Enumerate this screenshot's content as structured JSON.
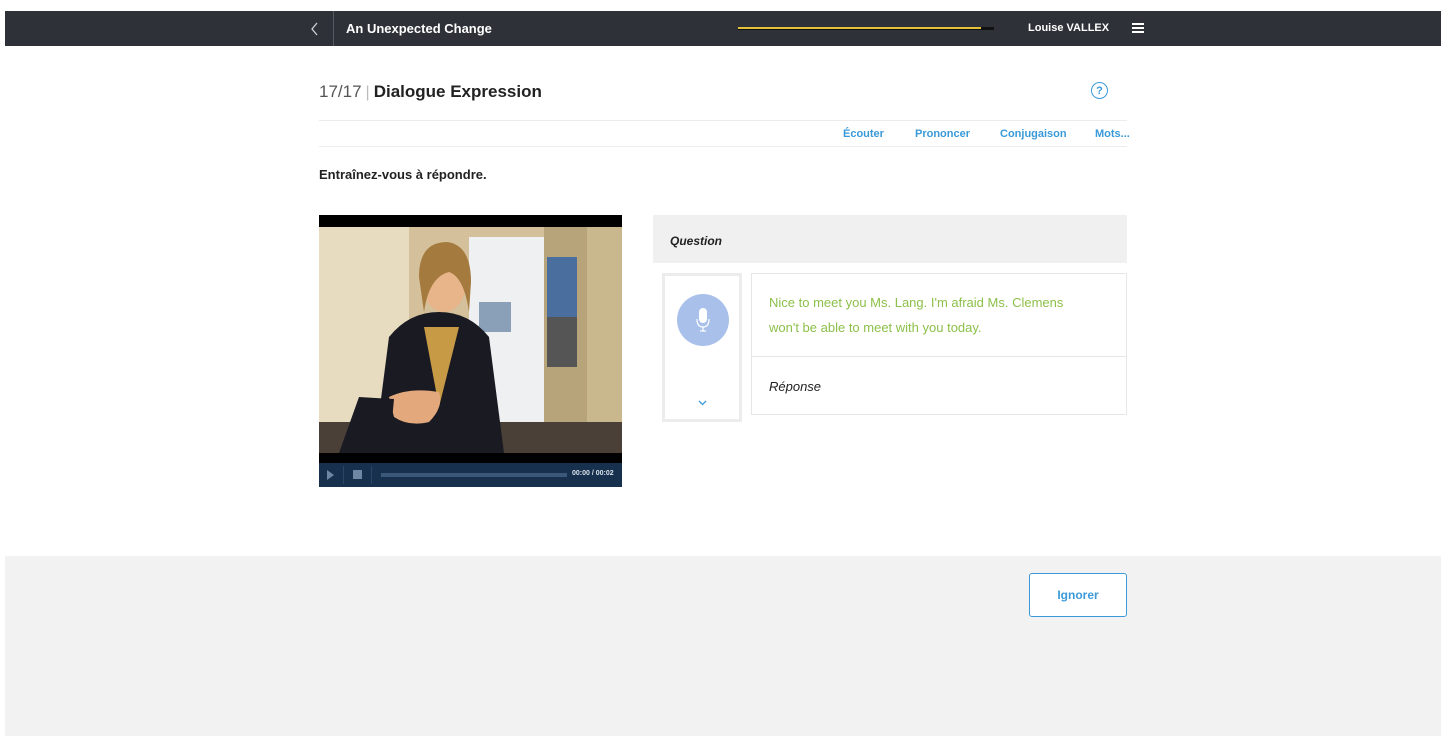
{
  "topbar": {
    "course_title": "An Unexpected Change",
    "user_name": "Louise VALLEX",
    "progress_fraction": 0.95,
    "progress_color": "#e3c23a"
  },
  "exercise": {
    "counter": "17/17",
    "title": "Dialogue Expression"
  },
  "tools": [
    "Écouter",
    "Prononcer",
    "Conjugaison",
    "Mots..."
  ],
  "instruction": "Entraînez-vous à répondre.",
  "video": {
    "time": "00:00 / 00:02"
  },
  "question": {
    "label": "Question",
    "line1": "Nice to meet you Ms. Lang. I'm afraid Ms. Clemens",
    "line2": "won't be able to meet with you today.",
    "answer_label": "Réponse"
  },
  "footer": {
    "skip_label": "Ignorer"
  },
  "colors": {
    "accent": "#3a9ad9",
    "question_text": "#8dc04a",
    "mic": "#a9c1ea",
    "topbar": "#2e3138"
  }
}
